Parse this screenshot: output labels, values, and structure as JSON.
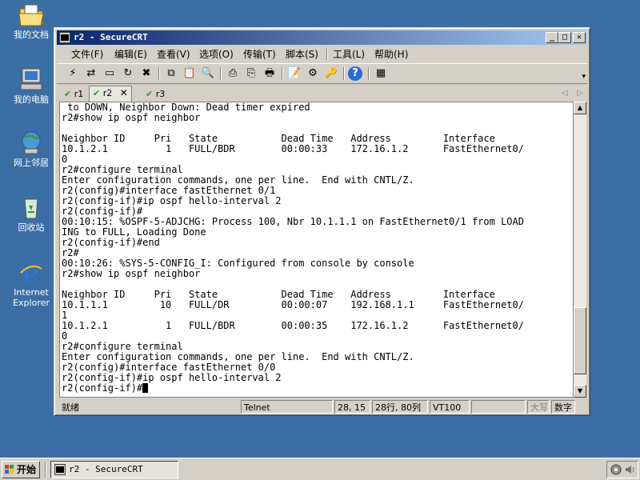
{
  "desktop": {
    "icons": [
      {
        "label": "我的文档",
        "icon": "my-documents-icon"
      },
      {
        "label": "我的电脑",
        "icon": "my-computer-icon"
      },
      {
        "label": "网上邻居",
        "icon": "network-icon"
      },
      {
        "label": "回收站",
        "icon": "recycle-bin-icon"
      },
      {
        "label": "Internet Explorer",
        "icon": "internet-explorer-icon"
      }
    ]
  },
  "window": {
    "title": "r2 - SecureCRT",
    "controls": {
      "minimize": "_",
      "maximize": "□",
      "close": "✕"
    }
  },
  "menu": {
    "items": [
      "文件(F)",
      "编辑(E)",
      "查看(V)",
      "选项(O)",
      "传输(T)",
      "脚本(S)",
      "工具(L)",
      "帮助(H)"
    ]
  },
  "toolbar": {
    "buttons": [
      {
        "icon": "connect-icon",
        "glyph": "⚡"
      },
      {
        "icon": "quick-connect-icon",
        "glyph": "⇄"
      },
      {
        "icon": "connect-in-tab-icon",
        "glyph": "▭"
      },
      {
        "icon": "reconnect-icon",
        "glyph": "↻"
      },
      {
        "icon": "disconnect-icon",
        "glyph": "✖"
      },
      {
        "icon": "copy-icon",
        "glyph": "⧉"
      },
      {
        "icon": "paste-icon",
        "glyph": "📋"
      },
      {
        "icon": "find-icon",
        "glyph": "🔍"
      },
      {
        "icon": "print-icon",
        "glyph": "⎙"
      },
      {
        "icon": "print-selection-icon",
        "glyph": "⎘"
      },
      {
        "icon": "print-setup-icon",
        "glyph": "🖶"
      },
      {
        "icon": "session-options-icon",
        "glyph": "📝"
      },
      {
        "icon": "global-options-icon",
        "glyph": "⚙"
      },
      {
        "icon": "keymap-icon",
        "glyph": "🔑"
      },
      {
        "icon": "help-icon",
        "glyph": "?"
      },
      {
        "icon": "map-icon",
        "glyph": "▦"
      }
    ],
    "more": "▾"
  },
  "tabs": [
    {
      "label": "r1",
      "active": false
    },
    {
      "label": "r2",
      "active": true
    },
    {
      "label": "r3",
      "active": false
    }
  ],
  "tab_close": "✕",
  "tab_nav": {
    "prev": "◁",
    "next": "▷"
  },
  "terminal": {
    "lines": [
      " to DOWN, Neighbor Down: Dead timer expired",
      "r2#show ip ospf neighbor",
      "",
      "Neighbor ID     Pri   State           Dead Time   Address         Interface",
      "10.1.2.1          1   FULL/BDR        00:00:33    172.16.1.2      FastEthernet0/",
      "0",
      "r2#configure terminal",
      "Enter configuration commands, one per line.  End with CNTL/Z.",
      "r2(config)#interface fastEthernet 0/1",
      "r2(config-if)#ip ospf hello-interval 2",
      "r2(config-if)#",
      "00:10:15: %OSPF-5-ADJCHG: Process 100, Nbr 10.1.1.1 on FastEthernet0/1 from LOAD",
      "ING to FULL, Loading Done",
      "r2(config-if)#end",
      "r2#",
      "00:10:26: %SYS-5-CONFIG_I: Configured from console by console",
      "r2#show ip ospf neighbor",
      "",
      "Neighbor ID     Pri   State           Dead Time   Address         Interface",
      "10.1.1.1         10   FULL/DR         00:00:07    192.168.1.1     FastEthernet0/",
      "1",
      "10.1.2.1          1   FULL/BDR        00:00:35    172.16.1.2      FastEthernet0/",
      "0",
      "r2#configure terminal",
      "Enter configuration commands, one per line.  End with CNTL/Z.",
      "r2(config)#interface fastEthernet 0/0",
      "r2(config-if)#ip ospf hello-interval 2",
      "r2(config-if)#"
    ],
    "scroll_position": 0.95
  },
  "status": {
    "ready": "就绪",
    "protocol": "Telnet",
    "cursor_pos": "28, 15",
    "size": "28行, 80列",
    "emulation": "VT100",
    "caps": "大写",
    "num": "数字"
  },
  "taskbar": {
    "start_label": "开始",
    "task_title": "r2 - SecureCRT"
  }
}
